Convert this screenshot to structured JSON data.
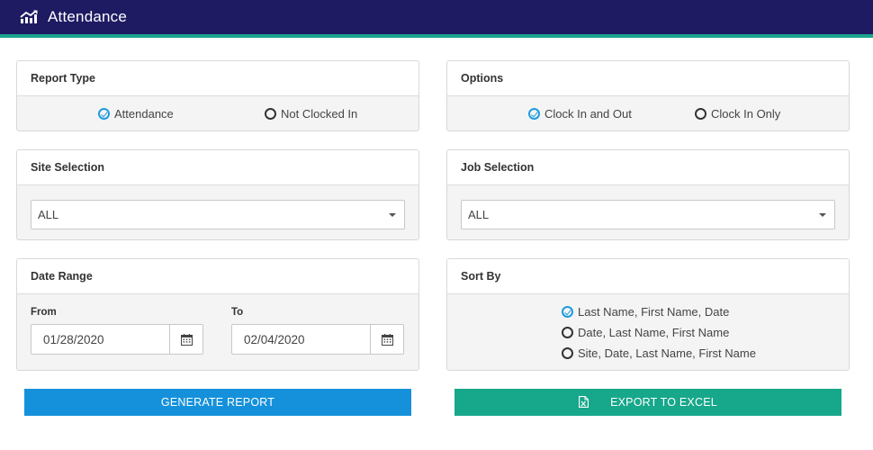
{
  "header": {
    "title": "Attendance",
    "icon": "bar-chart-trend-icon"
  },
  "colors": {
    "header_bg": "#1e1b63",
    "accent": "#1aa58e",
    "radio_checked": "#1e9be0",
    "generate_btn": "#1591db",
    "export_btn": "#17a78a"
  },
  "report_type": {
    "title": "Report Type",
    "options": [
      {
        "label": "Attendance",
        "checked": true
      },
      {
        "label": "Not Clocked In",
        "checked": false
      }
    ]
  },
  "options": {
    "title": "Options",
    "options": [
      {
        "label": "Clock In and Out",
        "checked": true
      },
      {
        "label": "Clock In Only",
        "checked": false
      }
    ]
  },
  "site_selection": {
    "title": "Site Selection",
    "value": "ALL"
  },
  "job_selection": {
    "title": "Job Selection",
    "value": "ALL"
  },
  "date_range": {
    "title": "Date Range",
    "from_label": "From",
    "from_value": "01/28/2020",
    "to_label": "To",
    "to_value": "02/04/2020"
  },
  "sort_by": {
    "title": "Sort By",
    "options": [
      {
        "label": "Last Name, First Name, Date",
        "checked": true
      },
      {
        "label": "Date, Last Name, First Name",
        "checked": false
      },
      {
        "label": "Site, Date, Last Name, First Name",
        "checked": false
      }
    ]
  },
  "actions": {
    "generate_label": "GENERATE REPORT",
    "export_label": "EXPORT TO EXCEL",
    "export_icon": "excel-file-icon"
  }
}
